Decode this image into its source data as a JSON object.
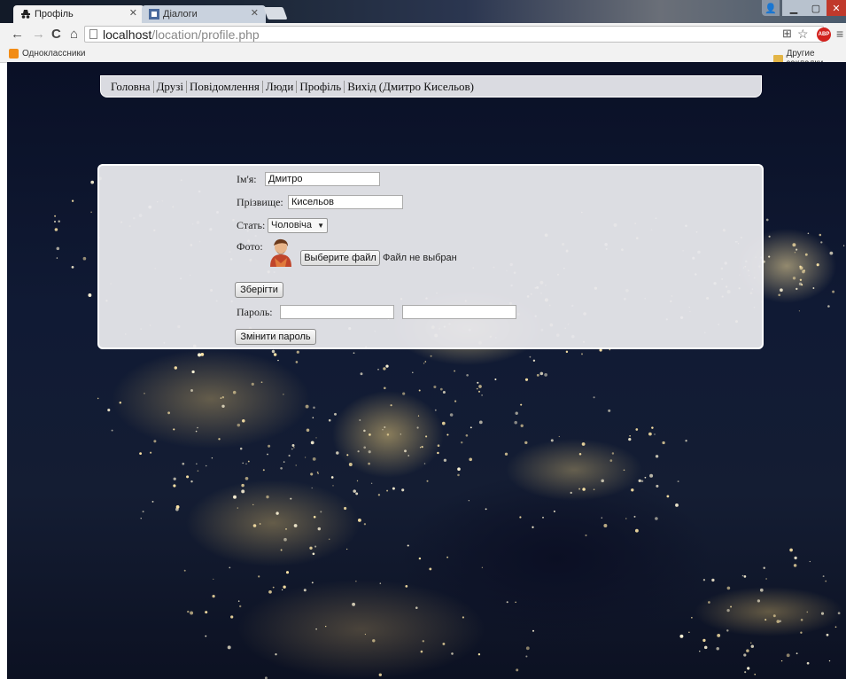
{
  "browser": {
    "tabs": [
      {
        "title": "Профіль",
        "active": true
      },
      {
        "title": "Діалоги",
        "active": false
      }
    ],
    "url_host": "localhost",
    "url_path": "/location/profile.php",
    "bookmarks": {
      "left": "Одноклассники",
      "right": "Другие закладки"
    },
    "icons": [
      "back-arrow-icon",
      "forward-arrow-icon",
      "reload-icon",
      "home-icon",
      "page-icon",
      "translate-icon",
      "star-icon",
      "adblock-icon",
      "menu-icon"
    ]
  },
  "menu": {
    "items": [
      "Головна",
      "Друзі",
      "Повідомлення",
      "Люди",
      "Профіль",
      "Вихід (Дмитро Кисельов)"
    ]
  },
  "profile": {
    "first_name_label": "Ім'я:",
    "first_name_value": "Дмитро",
    "last_name_label": "Прізвище:",
    "last_name_value": "Кисельов",
    "gender_label": "Стать:",
    "gender_value": "Чоловіча",
    "photo_label": "Фото:",
    "file_button": "Выберите файл",
    "file_status": "Файл не выбран",
    "save_button": "Зберігти",
    "password_label": "Пароль:",
    "change_password_button": "Змінити пароль"
  },
  "colors": {
    "close_button": "#c0392b",
    "adblock": "#d2221e",
    "odnoklassniki": "#f28c16"
  }
}
